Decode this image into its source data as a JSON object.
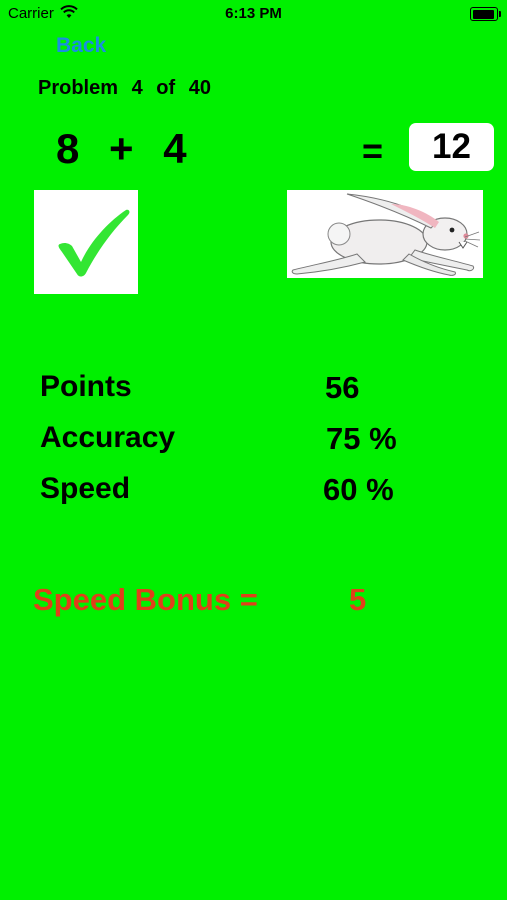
{
  "status_bar": {
    "carrier": "Carrier",
    "time": "6:13 PM"
  },
  "nav": {
    "back_label": "Back"
  },
  "problem": {
    "word": "Problem",
    "current": "4",
    "of_word": "of",
    "total": "40"
  },
  "equation": {
    "left": "8",
    "operator": "+",
    "right": "4",
    "equals": "=",
    "answer": "12"
  },
  "result": {
    "icon": "checkmark-icon",
    "speed_icon": "rabbit-icon",
    "check_color": "#33e633"
  },
  "stats": {
    "points_label": "Points",
    "points_value": "56",
    "accuracy_label": "Accuracy",
    "accuracy_value": "75 %",
    "speed_label": "Speed",
    "speed_value": "60 %"
  },
  "bonus": {
    "label": "Speed Bonus =",
    "value": "5",
    "color": "#e0401a"
  },
  "colors": {
    "background": "#00f000",
    "back_link": "#1a8ee0"
  }
}
